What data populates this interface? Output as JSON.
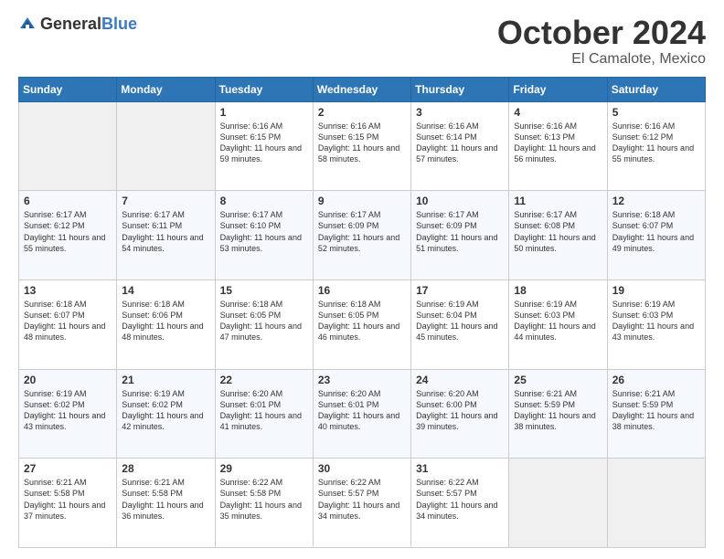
{
  "header": {
    "logo_general": "General",
    "logo_blue": "Blue",
    "month_year": "October 2024",
    "location": "El Camalote, Mexico"
  },
  "days_of_week": [
    "Sunday",
    "Monday",
    "Tuesday",
    "Wednesday",
    "Thursday",
    "Friday",
    "Saturday"
  ],
  "weeks": [
    [
      {
        "day": "",
        "empty": true
      },
      {
        "day": "",
        "empty": true
      },
      {
        "day": "1",
        "sunrise": "6:16 AM",
        "sunset": "6:15 PM",
        "daylight": "11 hours and 59 minutes."
      },
      {
        "day": "2",
        "sunrise": "6:16 AM",
        "sunset": "6:15 PM",
        "daylight": "11 hours and 58 minutes."
      },
      {
        "day": "3",
        "sunrise": "6:16 AM",
        "sunset": "6:14 PM",
        "daylight": "11 hours and 57 minutes."
      },
      {
        "day": "4",
        "sunrise": "6:16 AM",
        "sunset": "6:13 PM",
        "daylight": "11 hours and 56 minutes."
      },
      {
        "day": "5",
        "sunrise": "6:16 AM",
        "sunset": "6:12 PM",
        "daylight": "11 hours and 55 minutes."
      }
    ],
    [
      {
        "day": "6",
        "sunrise": "6:17 AM",
        "sunset": "6:12 PM",
        "daylight": "11 hours and 55 minutes."
      },
      {
        "day": "7",
        "sunrise": "6:17 AM",
        "sunset": "6:11 PM",
        "daylight": "11 hours and 54 minutes."
      },
      {
        "day": "8",
        "sunrise": "6:17 AM",
        "sunset": "6:10 PM",
        "daylight": "11 hours and 53 minutes."
      },
      {
        "day": "9",
        "sunrise": "6:17 AM",
        "sunset": "6:09 PM",
        "daylight": "11 hours and 52 minutes."
      },
      {
        "day": "10",
        "sunrise": "6:17 AM",
        "sunset": "6:09 PM",
        "daylight": "11 hours and 51 minutes."
      },
      {
        "day": "11",
        "sunrise": "6:17 AM",
        "sunset": "6:08 PM",
        "daylight": "11 hours and 50 minutes."
      },
      {
        "day": "12",
        "sunrise": "6:18 AM",
        "sunset": "6:07 PM",
        "daylight": "11 hours and 49 minutes."
      }
    ],
    [
      {
        "day": "13",
        "sunrise": "6:18 AM",
        "sunset": "6:07 PM",
        "daylight": "11 hours and 48 minutes."
      },
      {
        "day": "14",
        "sunrise": "6:18 AM",
        "sunset": "6:06 PM",
        "daylight": "11 hours and 48 minutes."
      },
      {
        "day": "15",
        "sunrise": "6:18 AM",
        "sunset": "6:05 PM",
        "daylight": "11 hours and 47 minutes."
      },
      {
        "day": "16",
        "sunrise": "6:18 AM",
        "sunset": "6:05 PM",
        "daylight": "11 hours and 46 minutes."
      },
      {
        "day": "17",
        "sunrise": "6:19 AM",
        "sunset": "6:04 PM",
        "daylight": "11 hours and 45 minutes."
      },
      {
        "day": "18",
        "sunrise": "6:19 AM",
        "sunset": "6:03 PM",
        "daylight": "11 hours and 44 minutes."
      },
      {
        "day": "19",
        "sunrise": "6:19 AM",
        "sunset": "6:03 PM",
        "daylight": "11 hours and 43 minutes."
      }
    ],
    [
      {
        "day": "20",
        "sunrise": "6:19 AM",
        "sunset": "6:02 PM",
        "daylight": "11 hours and 43 minutes."
      },
      {
        "day": "21",
        "sunrise": "6:19 AM",
        "sunset": "6:02 PM",
        "daylight": "11 hours and 42 minutes."
      },
      {
        "day": "22",
        "sunrise": "6:20 AM",
        "sunset": "6:01 PM",
        "daylight": "11 hours and 41 minutes."
      },
      {
        "day": "23",
        "sunrise": "6:20 AM",
        "sunset": "6:01 PM",
        "daylight": "11 hours and 40 minutes."
      },
      {
        "day": "24",
        "sunrise": "6:20 AM",
        "sunset": "6:00 PM",
        "daylight": "11 hours and 39 minutes."
      },
      {
        "day": "25",
        "sunrise": "6:21 AM",
        "sunset": "5:59 PM",
        "daylight": "11 hours and 38 minutes."
      },
      {
        "day": "26",
        "sunrise": "6:21 AM",
        "sunset": "5:59 PM",
        "daylight": "11 hours and 38 minutes."
      }
    ],
    [
      {
        "day": "27",
        "sunrise": "6:21 AM",
        "sunset": "5:58 PM",
        "daylight": "11 hours and 37 minutes."
      },
      {
        "day": "28",
        "sunrise": "6:21 AM",
        "sunset": "5:58 PM",
        "daylight": "11 hours and 36 minutes."
      },
      {
        "day": "29",
        "sunrise": "6:22 AM",
        "sunset": "5:58 PM",
        "daylight": "11 hours and 35 minutes."
      },
      {
        "day": "30",
        "sunrise": "6:22 AM",
        "sunset": "5:57 PM",
        "daylight": "11 hours and 34 minutes."
      },
      {
        "day": "31",
        "sunrise": "6:22 AM",
        "sunset": "5:57 PM",
        "daylight": "11 hours and 34 minutes."
      },
      {
        "day": "",
        "empty": true
      },
      {
        "day": "",
        "empty": true
      }
    ]
  ]
}
